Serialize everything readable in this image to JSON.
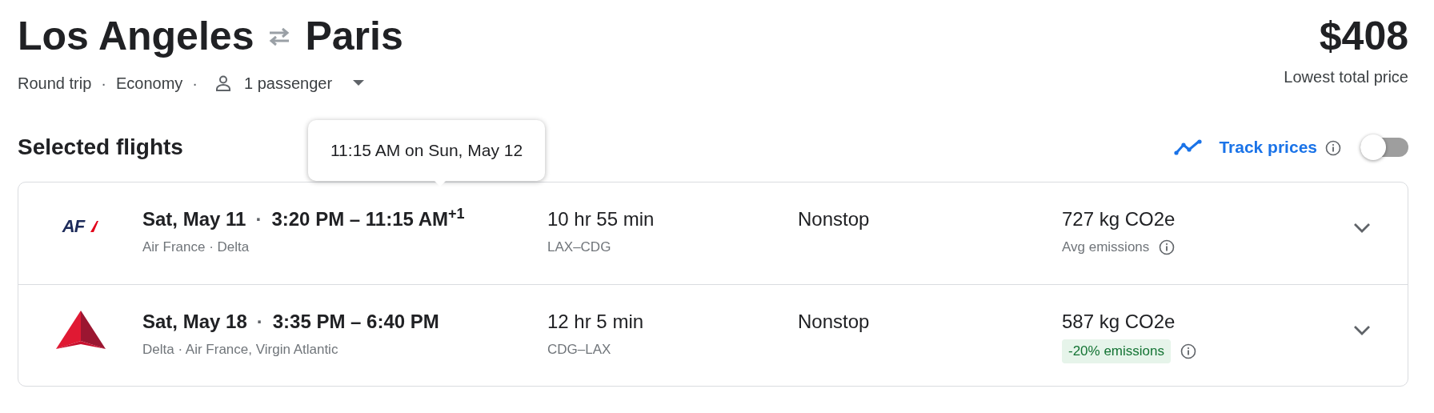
{
  "route": {
    "origin": "Los Angeles",
    "destination": "Paris"
  },
  "trip": {
    "type": "Round trip",
    "separator_1": "·",
    "cabin": "Economy",
    "separator_2": "·",
    "passengers": "1 passenger"
  },
  "price": {
    "amount": "$408",
    "caption": "Lowest total price"
  },
  "section_title": "Selected flights",
  "track_prices": {
    "label": "Track prices",
    "on": false
  },
  "tooltip": {
    "text": "11:15 AM on Sun, May 12"
  },
  "flights": [
    {
      "logo": {
        "kind": "wordmark",
        "text": "AF"
      },
      "date": "Sat, May 11",
      "separator": "·",
      "times": "3:20 PM – 11:15 AM$^{+1}$",
      "airlines": "Air France · Delta",
      "duration": "10 hr 55 min",
      "route": "LAX–CDG",
      "stops": "Nonstop",
      "emissions": "727 kg CO2e",
      "emissions_note": {
        "kind": "plain",
        "text": "Avg emissions"
      },
      "expanded": false
    },
    {
      "logo": {
        "kind": "triangle"
      },
      "date": "Sat, May 18",
      "separator": "·",
      "times": "3:35 PM – 6:40 PM",
      "airlines": "Delta · Air France, Virgin Atlantic",
      "duration": "12 hr 5 min",
      "route": "CDG–LAX",
      "stops": "Nonstop",
      "emissions": "587 kg CO2e",
      "emissions_note": {
        "kind": "badge",
        "text": "-20% emissions"
      },
      "expanded": false
    }
  ]
}
